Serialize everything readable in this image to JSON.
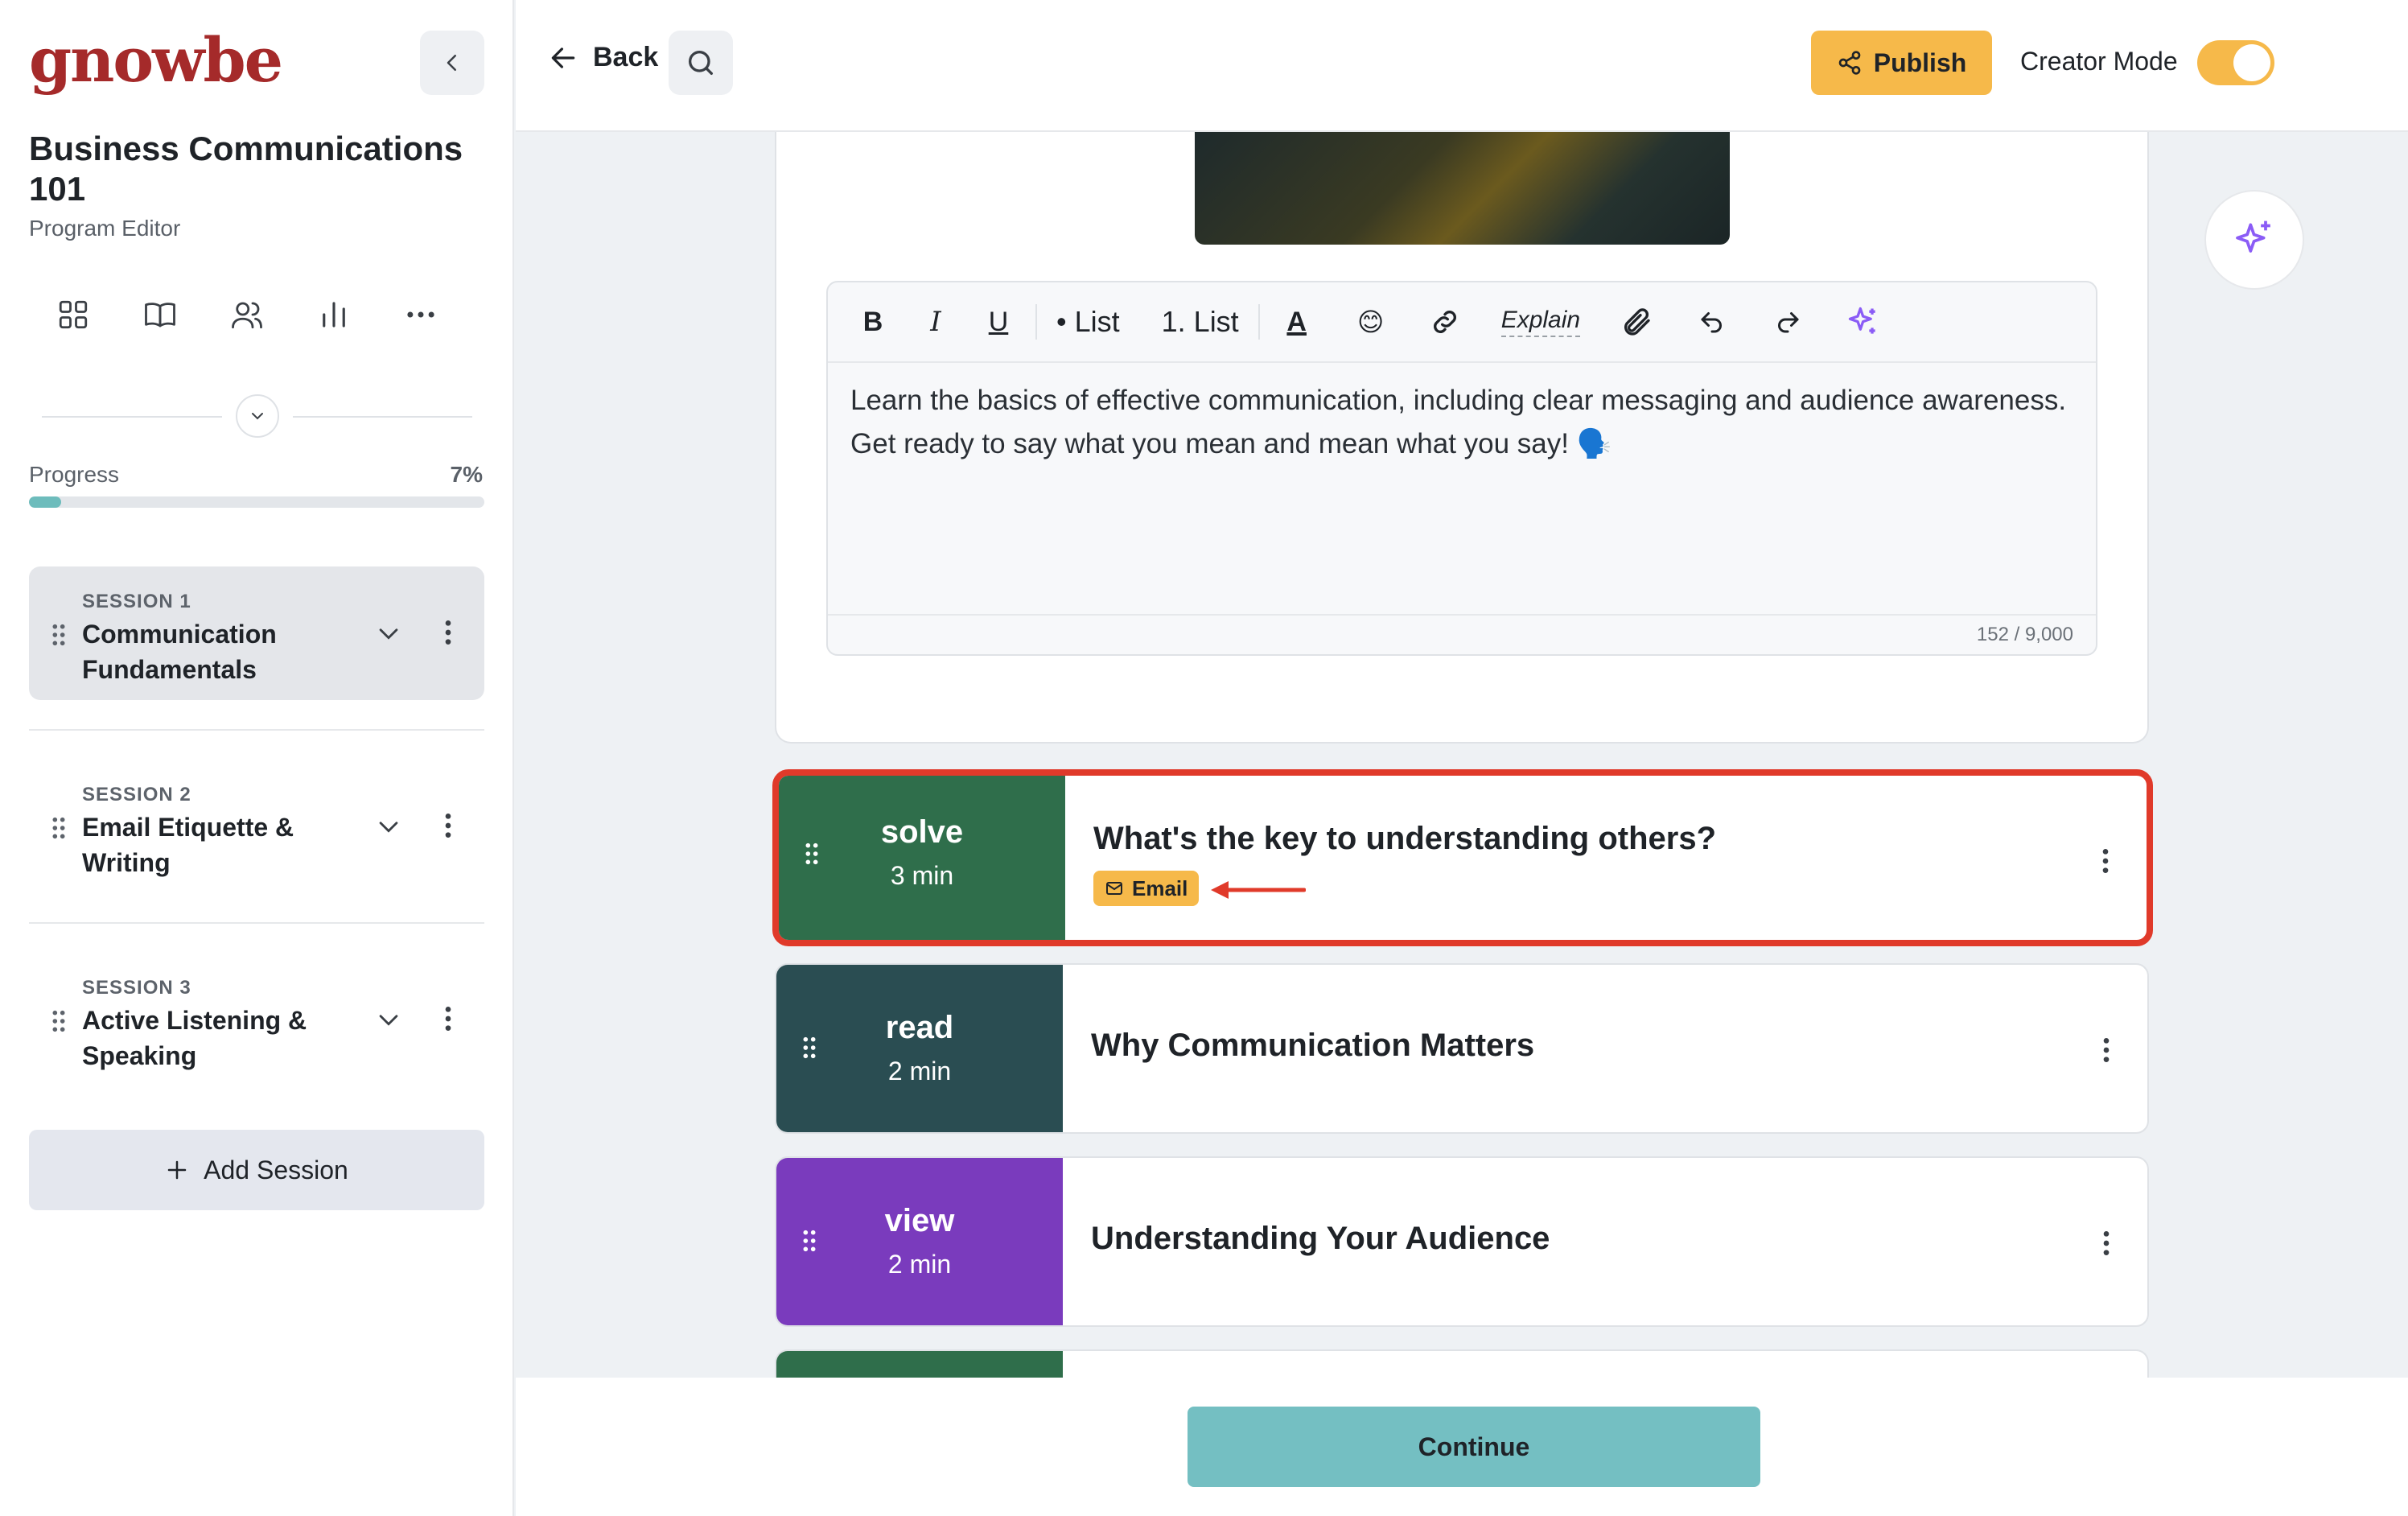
{
  "app": {
    "logo": "gnowbe"
  },
  "sidebar": {
    "program_title": "Business Communications 101",
    "program_subtitle": "Program Editor",
    "progress_label": "Progress",
    "progress_percent": "7%",
    "progress_value": 0.07,
    "nav_icons": [
      "grid-icon",
      "book-icon",
      "users-icon",
      "bar-chart-icon",
      "more-icon"
    ],
    "sessions": [
      {
        "number": "SESSION 1",
        "name": "Communication Fundamentals",
        "active": true
      },
      {
        "number": "SESSION 2",
        "name": "Email Etiquette & Writing",
        "active": false
      },
      {
        "number": "SESSION 3",
        "name": "Active Listening & Speaking",
        "active": false
      }
    ],
    "add_session_label": "Add Session"
  },
  "topbar": {
    "back_label": "Back",
    "publish_label": "Publish",
    "creator_mode_label": "Creator Mode",
    "creator_mode_on": true
  },
  "editor": {
    "toolbar": {
      "bold": "B",
      "italic": "I",
      "underline": "U",
      "bullet_list": "• List",
      "numbered_list": "1. List",
      "text_color": "A",
      "emoji": "😊",
      "explain": "Explain"
    },
    "body": "Learn the basics of effective communication, including clear messaging and audience awareness. Get ready to say what you mean and mean what you say! 🗣️",
    "char_count": "152 / 9,000"
  },
  "steps": [
    {
      "type": "solve",
      "duration": "3 min",
      "title": "What's the key to understanding others?",
      "badge": "Email",
      "color": "#2f6e4b",
      "highlighted": true
    },
    {
      "type": "read",
      "duration": "2 min",
      "title": "Why Communication Matters",
      "color": "#2a4d52",
      "highlighted": false
    },
    {
      "type": "view",
      "duration": "2 min",
      "title": "Understanding Your Audience",
      "color": "#7a3bbd",
      "highlighted": false
    }
  ],
  "footer": {
    "continue_label": "Continue"
  },
  "colors": {
    "accent": "#f6b94a",
    "brand": "#a52a2a",
    "teal": "#74bfc2",
    "highlight": "#e03a2a",
    "sparkle": "#8b5cf6"
  }
}
